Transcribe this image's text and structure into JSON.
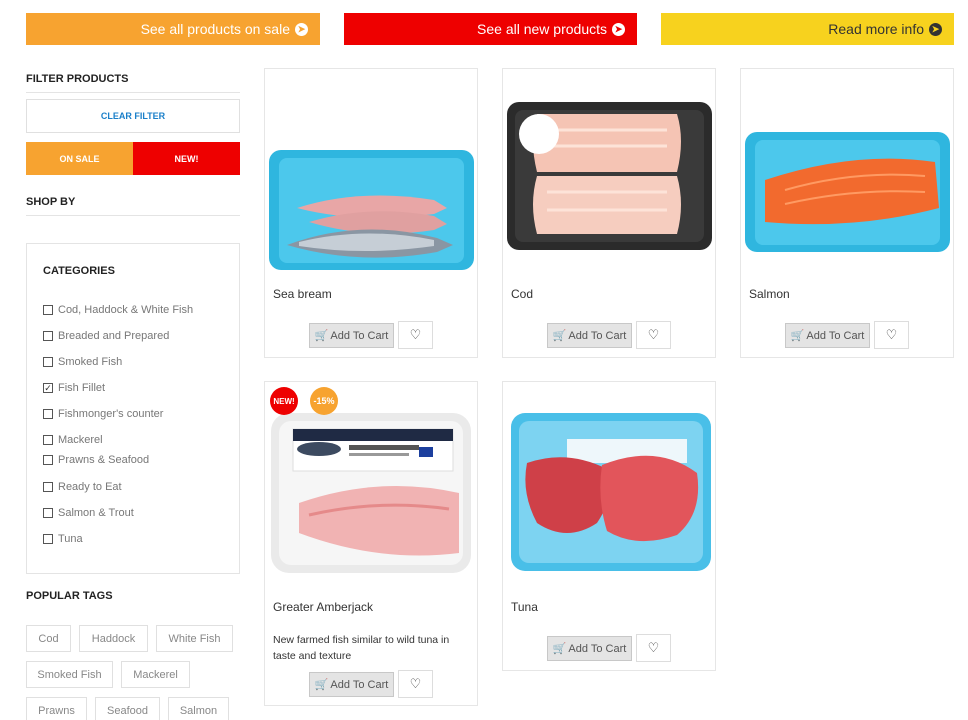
{
  "banners": {
    "sale": "See all products on sale",
    "new": "See all new products",
    "info": "Read more info"
  },
  "sidebar": {
    "filter_title": "FILTER PRODUCTS",
    "clear_filter": "CLEAR FILTER",
    "on_sale": "ON SALE",
    "new": "NEW!",
    "shop_by": "SHOP BY",
    "categories_title": "CATEGORIES",
    "categories": [
      {
        "label": "Cod, Haddock & White Fish",
        "checked": false
      },
      {
        "label": "Breaded and Prepared",
        "checked": false
      },
      {
        "label": "Smoked Fish",
        "checked": false
      },
      {
        "label": "Fish Fillet",
        "checked": true
      },
      {
        "label": "Fishmonger's counter",
        "checked": false
      },
      {
        "label": "Mackerel",
        "checked": false
      },
      {
        "label": "Prawns & Seafood",
        "checked": false
      },
      {
        "label": "Ready to Eat",
        "checked": false
      },
      {
        "label": "Salmon & Trout",
        "checked": false
      },
      {
        "label": "Tuna",
        "checked": false
      }
    ],
    "tags_title": "POPULAR TAGS",
    "tags": [
      "Cod",
      "Haddock",
      "White Fish",
      "Smoked Fish",
      "Mackerel",
      "Prawns",
      "Seafood",
      "Salmon"
    ]
  },
  "products": [
    {
      "name": "Sea bream",
      "image": "sea-bream-fillets-in-blue-tray",
      "add_label": "Add To Cart"
    },
    {
      "name": "Cod",
      "image": "cod-fillets-in-black-tray",
      "add_label": "Add To Cart"
    },
    {
      "name": "Salmon",
      "image": "salmon-fillet-in-blue-tray",
      "add_label": "Add To Cart"
    },
    {
      "name": "Greater Amberjack",
      "image": "amberjack-fillet-in-clear-tray",
      "description": "New farmed fish similar to wild tuna in taste and texture",
      "add_label": "Add To Cart",
      "badges": [
        "NEW!",
        "-15%"
      ]
    },
    {
      "name": "Tuna",
      "image": "tuna-steaks-in-blue-tray",
      "add_label": "Add To Cart"
    }
  ],
  "colors": {
    "sale_orange": "#f7a330",
    "new_red": "#ee0000",
    "info_yellow": "#f7d21e",
    "link_blue": "#1a7fc9"
  }
}
